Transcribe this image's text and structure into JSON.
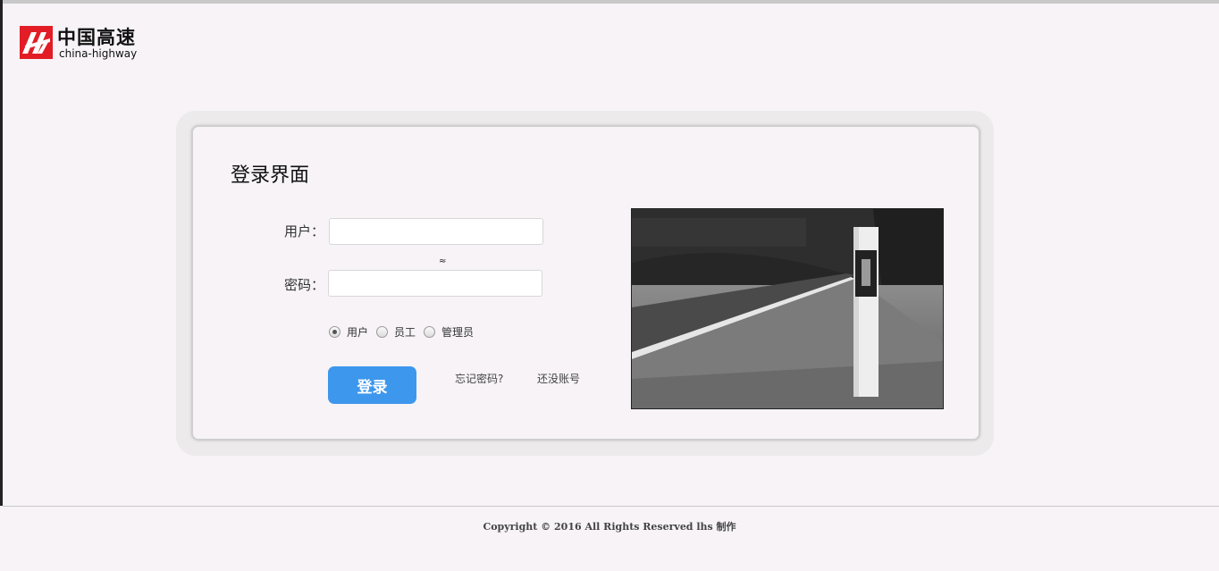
{
  "logo": {
    "name_cn": "中国高速",
    "name_en": "china-highway",
    "mark_color": "#e21d25"
  },
  "login": {
    "title": "登录界面",
    "username_label": "用户：",
    "username_value": "",
    "password_label": "密码：",
    "password_value": "",
    "roles": [
      {
        "label": "用户",
        "checked": true
      },
      {
        "label": "员工",
        "checked": false
      },
      {
        "label": "管理员",
        "checked": false
      }
    ],
    "submit_label": "登录",
    "forgot_password": "忘记密码?",
    "register": "还没账号"
  },
  "photo": {
    "subject": "roadside marker post beside a highway, grayscale"
  },
  "footer": {
    "copyright": "Copyright © 2016 All Rights Reserved lhs 制作"
  },
  "colors": {
    "button": "#3d97ec",
    "background": "#f7f3f6"
  }
}
